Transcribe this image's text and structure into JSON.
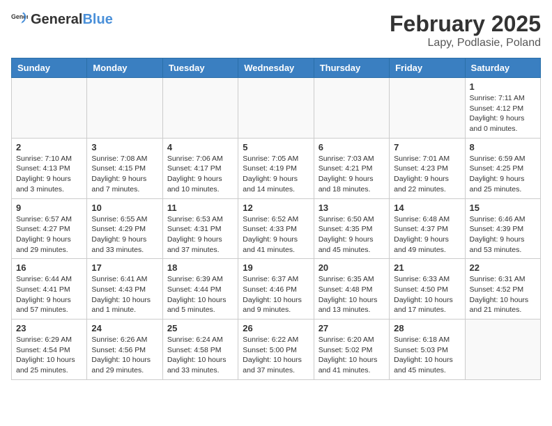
{
  "header": {
    "logo_general": "General",
    "logo_blue": "Blue",
    "month_title": "February 2025",
    "subtitle": "Lapy, Podlasie, Poland"
  },
  "days_of_week": [
    "Sunday",
    "Monday",
    "Tuesday",
    "Wednesday",
    "Thursday",
    "Friday",
    "Saturday"
  ],
  "weeks": [
    [
      {
        "day": "",
        "info": ""
      },
      {
        "day": "",
        "info": ""
      },
      {
        "day": "",
        "info": ""
      },
      {
        "day": "",
        "info": ""
      },
      {
        "day": "",
        "info": ""
      },
      {
        "day": "",
        "info": ""
      },
      {
        "day": "1",
        "info": "Sunrise: 7:11 AM\nSunset: 4:12 PM\nDaylight: 9 hours and 0 minutes."
      }
    ],
    [
      {
        "day": "2",
        "info": "Sunrise: 7:10 AM\nSunset: 4:13 PM\nDaylight: 9 hours and 3 minutes."
      },
      {
        "day": "3",
        "info": "Sunrise: 7:08 AM\nSunset: 4:15 PM\nDaylight: 9 hours and 7 minutes."
      },
      {
        "day": "4",
        "info": "Sunrise: 7:06 AM\nSunset: 4:17 PM\nDaylight: 9 hours and 10 minutes."
      },
      {
        "day": "5",
        "info": "Sunrise: 7:05 AM\nSunset: 4:19 PM\nDaylight: 9 hours and 14 minutes."
      },
      {
        "day": "6",
        "info": "Sunrise: 7:03 AM\nSunset: 4:21 PM\nDaylight: 9 hours and 18 minutes."
      },
      {
        "day": "7",
        "info": "Sunrise: 7:01 AM\nSunset: 4:23 PM\nDaylight: 9 hours and 22 minutes."
      },
      {
        "day": "8",
        "info": "Sunrise: 6:59 AM\nSunset: 4:25 PM\nDaylight: 9 hours and 25 minutes."
      }
    ],
    [
      {
        "day": "9",
        "info": "Sunrise: 6:57 AM\nSunset: 4:27 PM\nDaylight: 9 hours and 29 minutes."
      },
      {
        "day": "10",
        "info": "Sunrise: 6:55 AM\nSunset: 4:29 PM\nDaylight: 9 hours and 33 minutes."
      },
      {
        "day": "11",
        "info": "Sunrise: 6:53 AM\nSunset: 4:31 PM\nDaylight: 9 hours and 37 minutes."
      },
      {
        "day": "12",
        "info": "Sunrise: 6:52 AM\nSunset: 4:33 PM\nDaylight: 9 hours and 41 minutes."
      },
      {
        "day": "13",
        "info": "Sunrise: 6:50 AM\nSunset: 4:35 PM\nDaylight: 9 hours and 45 minutes."
      },
      {
        "day": "14",
        "info": "Sunrise: 6:48 AM\nSunset: 4:37 PM\nDaylight: 9 hours and 49 minutes."
      },
      {
        "day": "15",
        "info": "Sunrise: 6:46 AM\nSunset: 4:39 PM\nDaylight: 9 hours and 53 minutes."
      }
    ],
    [
      {
        "day": "16",
        "info": "Sunrise: 6:44 AM\nSunset: 4:41 PM\nDaylight: 9 hours and 57 minutes."
      },
      {
        "day": "17",
        "info": "Sunrise: 6:41 AM\nSunset: 4:43 PM\nDaylight: 10 hours and 1 minute."
      },
      {
        "day": "18",
        "info": "Sunrise: 6:39 AM\nSunset: 4:44 PM\nDaylight: 10 hours and 5 minutes."
      },
      {
        "day": "19",
        "info": "Sunrise: 6:37 AM\nSunset: 4:46 PM\nDaylight: 10 hours and 9 minutes."
      },
      {
        "day": "20",
        "info": "Sunrise: 6:35 AM\nSunset: 4:48 PM\nDaylight: 10 hours and 13 minutes."
      },
      {
        "day": "21",
        "info": "Sunrise: 6:33 AM\nSunset: 4:50 PM\nDaylight: 10 hours and 17 minutes."
      },
      {
        "day": "22",
        "info": "Sunrise: 6:31 AM\nSunset: 4:52 PM\nDaylight: 10 hours and 21 minutes."
      }
    ],
    [
      {
        "day": "23",
        "info": "Sunrise: 6:29 AM\nSunset: 4:54 PM\nDaylight: 10 hours and 25 minutes."
      },
      {
        "day": "24",
        "info": "Sunrise: 6:26 AM\nSunset: 4:56 PM\nDaylight: 10 hours and 29 minutes."
      },
      {
        "day": "25",
        "info": "Sunrise: 6:24 AM\nSunset: 4:58 PM\nDaylight: 10 hours and 33 minutes."
      },
      {
        "day": "26",
        "info": "Sunrise: 6:22 AM\nSunset: 5:00 PM\nDaylight: 10 hours and 37 minutes."
      },
      {
        "day": "27",
        "info": "Sunrise: 6:20 AM\nSunset: 5:02 PM\nDaylight: 10 hours and 41 minutes."
      },
      {
        "day": "28",
        "info": "Sunrise: 6:18 AM\nSunset: 5:03 PM\nDaylight: 10 hours and 45 minutes."
      },
      {
        "day": "",
        "info": ""
      }
    ]
  ]
}
